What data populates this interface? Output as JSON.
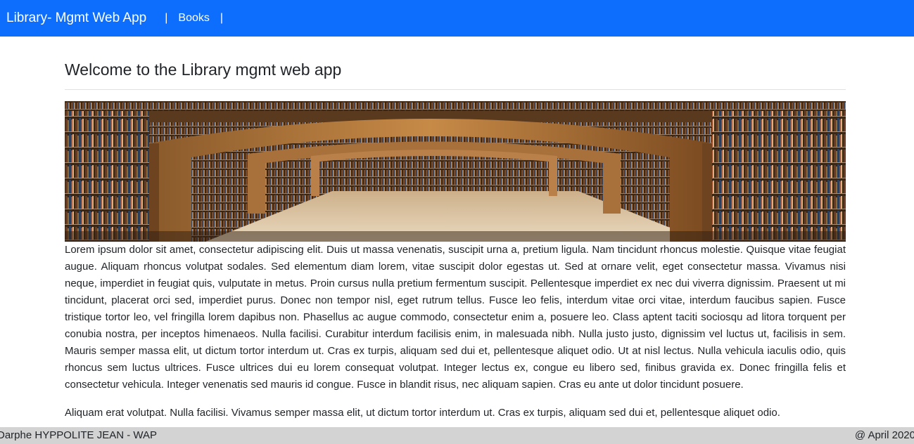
{
  "navbar": {
    "brand": "Library- Mgmt Web App",
    "separator": "|",
    "links": [
      {
        "label": "Books"
      }
    ],
    "background_color": "#0d6efd"
  },
  "main": {
    "title": "Welcome to the Library mgmt web app",
    "hero_image": {
      "icon": "library-interior-photo"
    },
    "paragraphs": [
      "Lorem ipsum dolor sit amet, consectetur adipiscing elit. Duis ut massa venenatis, suscipit urna a, pretium ligula. Nam tincidunt rhoncus molestie. Quisque vitae feugiat augue. Aliquam rhoncus volutpat sodales. Sed elementum diam lorem, vitae suscipit dolor egestas ut. Sed at ornare velit, eget consectetur massa. Vivamus nisi neque, imperdiet in feugiat quis, vulputate in metus. Proin cursus nulla pretium fermentum suscipit. Pellentesque imperdiet ex nec dui viverra dignissim. Praesent ut mi tincidunt, placerat orci sed, imperdiet purus. Donec non tempor nisl, eget rutrum tellus. Fusce leo felis, interdum vitae orci vitae, interdum faucibus sapien. Fusce tristique tortor leo, vel fringilla lorem dapibus non. Phasellus ac augue commodo, consectetur enim a, posuere leo. Class aptent taciti sociosqu ad litora torquent per conubia nostra, per inceptos himenaeos. Nulla facilisi. Curabitur interdum facilisis enim, in malesuada nibh. Nulla justo justo, dignissim vel luctus ut, facilisis in sem. Mauris semper massa elit, ut dictum tortor interdum ut. Cras ex turpis, aliquam sed dui et, pellentesque aliquet odio. Ut at nisl lectus. Nulla vehicula iaculis odio, quis rhoncus sem luctus ultrices. Fusce ultrices dui eu lorem consequat volutpat. Integer lectus ex, congue eu libero sed, finibus gravida ex. Donec fringilla felis et consectetur vehicula. Integer venenatis sed mauris id congue. Fusce in blandit risus, nec aliquam sapien. Cras eu ante ut dolor tincidunt posuere.",
      "Aliquam erat volutpat. Nulla facilisi. Vivamus semper massa elit, ut dictum tortor interdum ut. Cras ex turpis, aliquam sed dui et, pellentesque aliquet odio."
    ]
  },
  "footer": {
    "left": "Darphe HYPPOLITE JEAN - WAP",
    "right": "@ April 2020",
    "background_color": "#d3d3d3"
  }
}
